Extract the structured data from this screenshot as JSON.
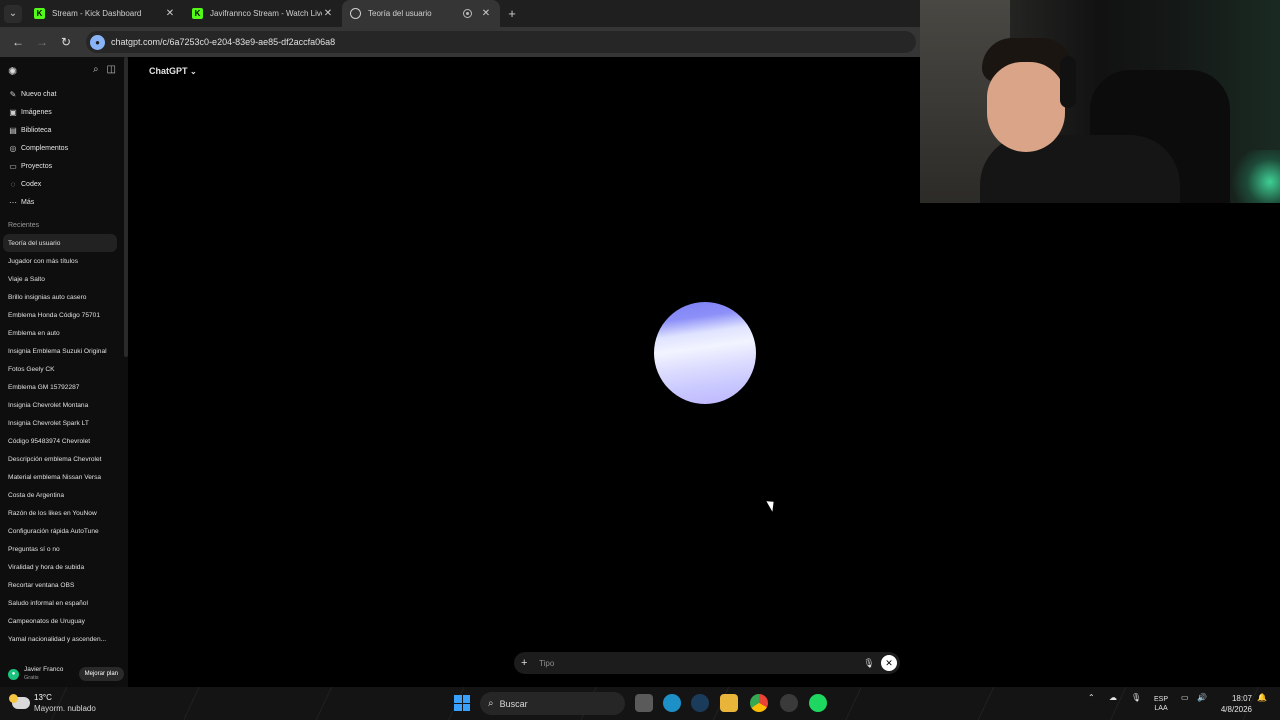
{
  "browser": {
    "tabs": [
      {
        "label": "Stream - Kick Dashboard",
        "favicon": "kick-icon",
        "active": false
      },
      {
        "label": "Javifrannco Stream - Watch Live",
        "favicon": "kick-icon",
        "active": false
      },
      {
        "label": "Teoría del usuario",
        "favicon": "chatgpt-icon",
        "active": true
      }
    ],
    "url": "chatgpt.com/c/6a7253c0-e204-83e9-ae85-df2accfa06a8"
  },
  "sidebar": {
    "nav": [
      {
        "label": "Nuevo chat",
        "icon": "edit-icon"
      },
      {
        "label": "Imágenes",
        "icon": "image-icon"
      },
      {
        "label": "Biblioteca",
        "icon": "library-icon"
      },
      {
        "label": "Complementos",
        "icon": "plugin-icon"
      },
      {
        "label": "Proyectos",
        "icon": "folder-icon"
      },
      {
        "label": "Codex",
        "icon": "codex-icon"
      },
      {
        "label": "Más",
        "icon": "more-icon"
      }
    ],
    "recents_header": "Recientes",
    "recents": [
      "Teoría del usuario",
      "Jugador con más títulos",
      "Viaje a Salto",
      "Brillo insignias auto casero",
      "Emblema Honda Código 75701",
      "Emblema en auto",
      "Insignia Emblema Suzuki Original",
      "Fotos Geely CK",
      "Emblema GM 15792287",
      "Insignia Chevrolet Montana",
      "Insignia Chevrolet Spark LT",
      "Código 95483974 Chevrolet",
      "Descripción emblema Chevrolet",
      "Material emblema Nissan Versa",
      "Costa de Argentina",
      "Razón de los likes en YouNow",
      "Configuración rápida AutoTune",
      "Preguntas sí o no",
      "Viralidad y hora de subida",
      "Recortar ventana OBS",
      "Saludo informal en español",
      "Campeonatos de Uruguay",
      "Yamal nacionalidad y ascenden..."
    ],
    "account": {
      "name": "Javier Franco",
      "plan": "Gratis",
      "upgrade_label": "Mejorar plan"
    }
  },
  "main": {
    "model_label": "ChatGPT",
    "composer_placeholder": "Tipo"
  },
  "taskbar": {
    "weather_temp": "13°C",
    "weather_desc": "Mayorm. nublado",
    "search_label": "Buscar",
    "lang_top": "ESP",
    "lang_bottom": "LAA",
    "time": "18:07",
    "date": "4/8/2026"
  },
  "colors": {
    "kick_green": "#53fc18",
    "accent_blue": "#3aa0ff",
    "orb_top": "#7b7ff5",
    "orb_bottom": "#bdb6ff"
  }
}
